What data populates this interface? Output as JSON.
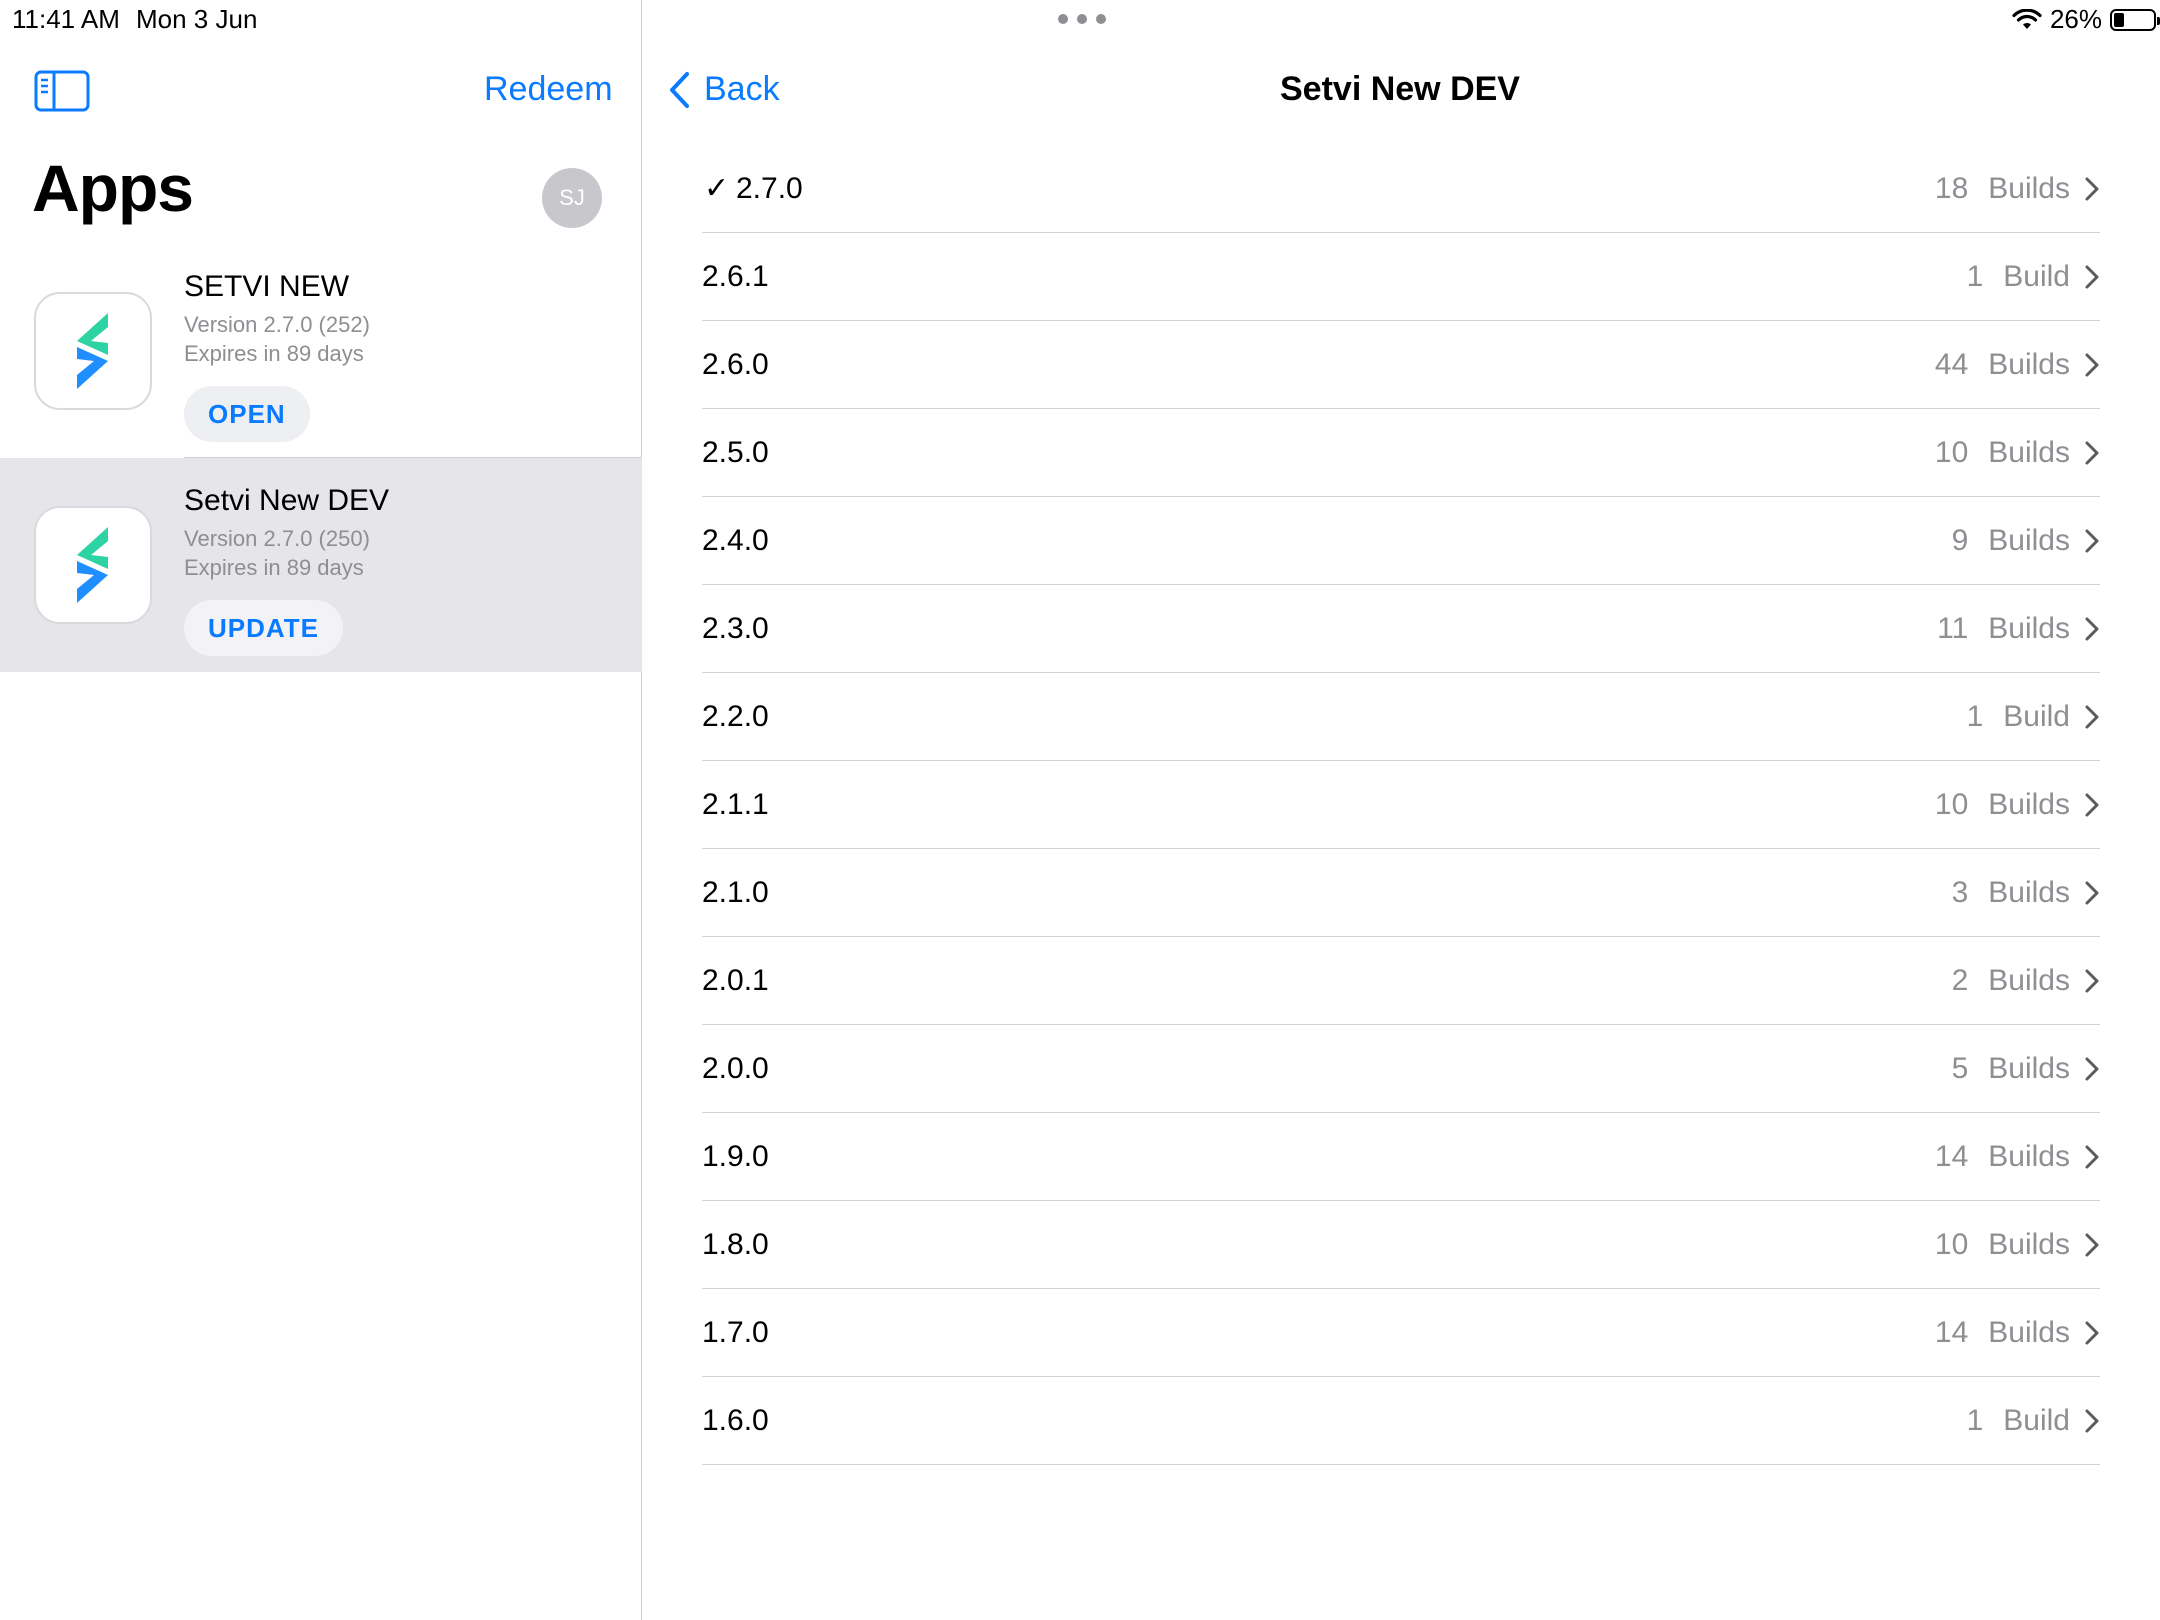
{
  "status_bar": {
    "time": "11:41 AM",
    "date": "Mon 3 Jun",
    "battery": "26%",
    "battery_level": 0.26
  },
  "sidebar": {
    "redeem_label": "Redeem",
    "title": "Apps",
    "avatar_initials": "SJ",
    "apps": [
      {
        "name": "SETVI NEW",
        "version": "Version 2.7.0 (252)",
        "expires": "Expires in 89 days",
        "button": "OPEN"
      },
      {
        "name": "Setvi New DEV",
        "version": "Version 2.7.0 (250)",
        "expires": "Expires in 89 days",
        "button": "UPDATE"
      }
    ]
  },
  "detail": {
    "back_label": "Back",
    "title": "Setvi New DEV",
    "versions": [
      {
        "version": "2.7.0",
        "count": "18",
        "unit": "Builds",
        "selected": true
      },
      {
        "version": "2.6.1",
        "count": "1",
        "unit": "Build"
      },
      {
        "version": "2.6.0",
        "count": "44",
        "unit": "Builds"
      },
      {
        "version": "2.5.0",
        "count": "10",
        "unit": "Builds"
      },
      {
        "version": "2.4.0",
        "count": "9",
        "unit": "Builds"
      },
      {
        "version": "2.3.0",
        "count": "11",
        "unit": "Builds"
      },
      {
        "version": "2.2.0",
        "count": "1",
        "unit": "Build"
      },
      {
        "version": "2.1.1",
        "count": "10",
        "unit": "Builds"
      },
      {
        "version": "2.1.0",
        "count": "3",
        "unit": "Builds"
      },
      {
        "version": "2.0.1",
        "count": "2",
        "unit": "Builds"
      },
      {
        "version": "2.0.0",
        "count": "5",
        "unit": "Builds"
      },
      {
        "version": "1.9.0",
        "count": "14",
        "unit": "Builds"
      },
      {
        "version": "1.8.0",
        "count": "10",
        "unit": "Builds"
      },
      {
        "version": "1.7.0",
        "count": "14",
        "unit": "Builds"
      },
      {
        "version": "1.6.0",
        "count": "1",
        "unit": "Build"
      }
    ]
  },
  "colors": {
    "accent": "#0a7aff",
    "secondary_text": "#8e8e93",
    "selected_row": "#e5e5ea"
  }
}
